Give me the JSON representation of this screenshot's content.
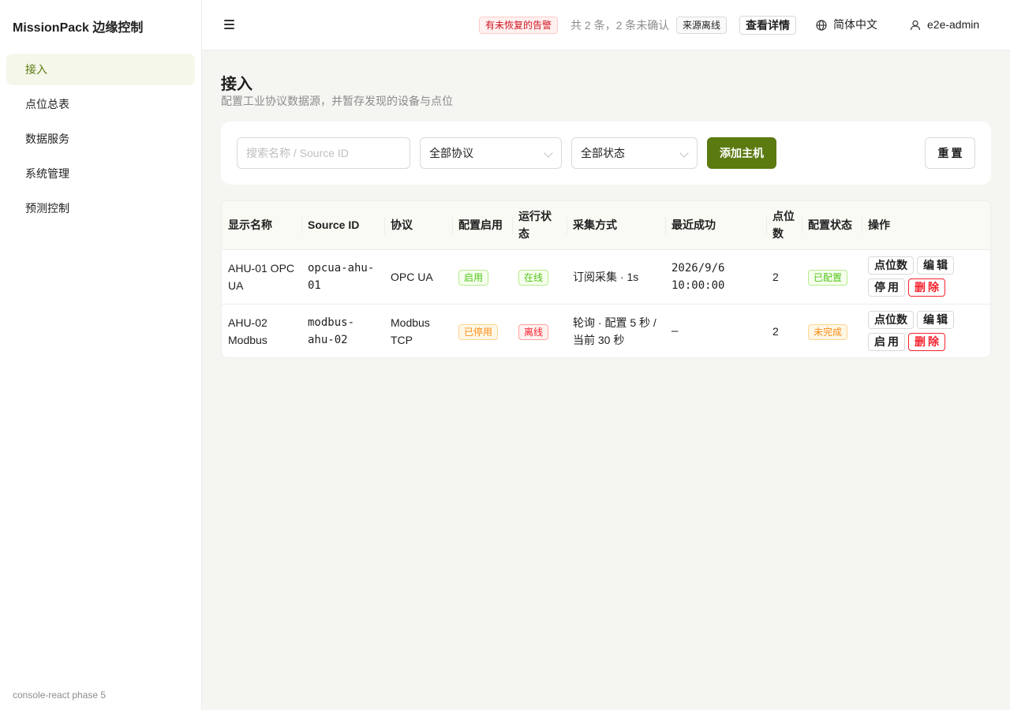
{
  "app": {
    "brand": "MissionPack 边缘控制",
    "footer": "console-react phase 5"
  },
  "sidebar": {
    "items": [
      {
        "label": "接入",
        "active": true
      },
      {
        "label": "点位总表"
      },
      {
        "label": "数据服务"
      },
      {
        "label": "系统管理"
      },
      {
        "label": "预测控制"
      }
    ]
  },
  "header": {
    "alert_tag": "有未恢复的告警",
    "alert_count": "共 2 条，2 条未确认",
    "source_tag": "来源离线",
    "detail_button": "查看详情",
    "language": "简体中文",
    "user": "e2e-admin",
    "icons": [
      "menu-icon",
      "globe-icon",
      "user-icon"
    ]
  },
  "page": {
    "title": "接入",
    "subtitle": "配置工业协议数据源，并暂存发现的设备与点位"
  },
  "filters": {
    "search_placeholder": "搜索名称 / Source ID",
    "search_value": "",
    "protocol_select": "全部协议",
    "status_select": "全部状态",
    "add_button": "添加主机",
    "reset_button": "重置"
  },
  "table": {
    "columns": [
      "显示名称",
      "Source ID",
      "协议",
      "配置启用",
      "运行状态",
      "采集方式",
      "最近成功",
      "点位数",
      "配置状态",
      "操作"
    ],
    "rows": [
      {
        "name": "AHU-01 OPC UA",
        "source_id": "opcua-ahu-01",
        "protocol": "OPC UA",
        "enabled": "启用",
        "runtime": "在线",
        "collect": "订阅采集 · 1s",
        "last_success": "2026/9/6 10:00:00",
        "points": "2",
        "config_status": "已配置",
        "actions": [
          "点位数",
          "编辑",
          "停用",
          "删除"
        ]
      },
      {
        "name": "AHU-02 Modbus",
        "source_id": "modbus-ahu-02",
        "protocol": "Modbus TCP",
        "enabled": "已停用",
        "runtime": "离线",
        "collect": "轮询 · 配置 5 秒 / 当前 30 秒",
        "last_success": "—",
        "points": "2",
        "config_status": "未完成",
        "actions": [
          "点位数",
          "编辑",
          "启用",
          "删除"
        ]
      }
    ]
  },
  "colors": {
    "accent": "#5b7a10",
    "active_bg": "#f5f7ea",
    "danger": "#f5222d",
    "success": "#52c41a",
    "warning": "#fa8c16"
  }
}
